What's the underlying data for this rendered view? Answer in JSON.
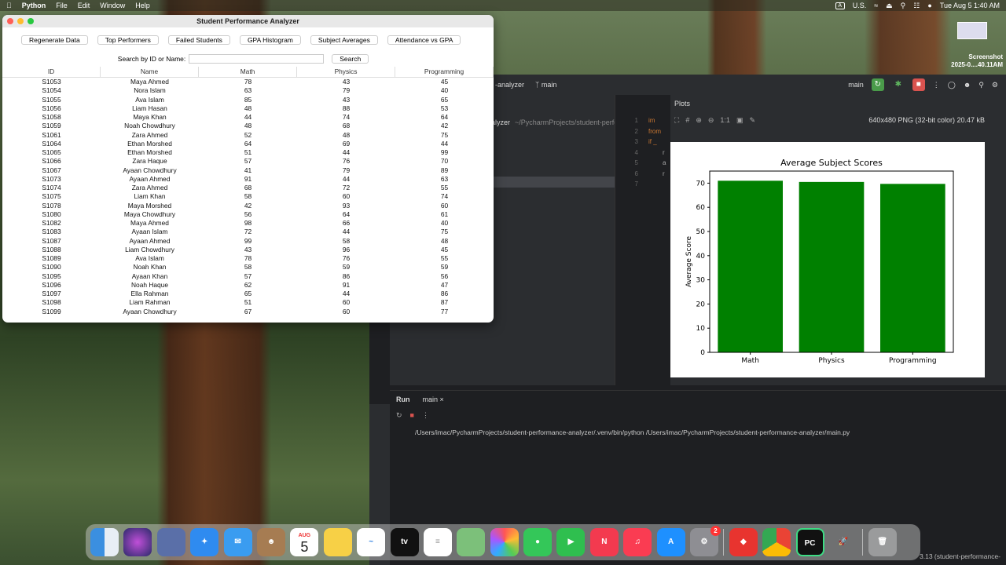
{
  "menubar": {
    "app": "Python",
    "items": [
      "File",
      "Edit",
      "Window",
      "Help"
    ],
    "input_lang": "U.S.",
    "datetime": "Tue Aug 5  1:40 AM"
  },
  "screenshot_thumb": {
    "title": "Screenshot",
    "subtitle": "2025-0....40.11AM"
  },
  "window": {
    "title": "Student Performance Analyzer",
    "buttons": [
      "Regenerate Data",
      "Top Performers",
      "Failed Students",
      "GPA Histogram",
      "Subject Averages",
      "Attendance vs GPA"
    ],
    "search_label": "Search by ID or Name:",
    "search_value": "",
    "search_button": "Search",
    "columns": [
      "ID",
      "Name",
      "Math",
      "Physics",
      "Programming"
    ],
    "rows": [
      [
        "S1053",
        "Maya Ahmed",
        "78",
        "43",
        "45"
      ],
      [
        "S1054",
        "Nora Islam",
        "63",
        "79",
        "40"
      ],
      [
        "S1055",
        "Ava Islam",
        "85",
        "43",
        "65"
      ],
      [
        "S1056",
        "Liam Hasan",
        "48",
        "88",
        "53"
      ],
      [
        "S1058",
        "Maya Khan",
        "44",
        "74",
        "64"
      ],
      [
        "S1059",
        "Noah Chowdhury",
        "48",
        "68",
        "42"
      ],
      [
        "S1061",
        "Zara Ahmed",
        "52",
        "48",
        "75"
      ],
      [
        "S1064",
        "Ethan Morshed",
        "64",
        "69",
        "44"
      ],
      [
        "S1065",
        "Ethan Morshed",
        "51",
        "44",
        "99"
      ],
      [
        "S1066",
        "Zara Haque",
        "57",
        "76",
        "70"
      ],
      [
        "S1067",
        "Ayaan Chowdhury",
        "41",
        "79",
        "89"
      ],
      [
        "S1073",
        "Ayaan Ahmed",
        "91",
        "44",
        "63"
      ],
      [
        "S1074",
        "Zara Ahmed",
        "68",
        "72",
        "55"
      ],
      [
        "S1075",
        "Liam Khan",
        "58",
        "60",
        "74"
      ],
      [
        "S1078",
        "Maya Morshed",
        "42",
        "93",
        "60"
      ],
      [
        "S1080",
        "Maya Chowdhury",
        "56",
        "64",
        "61"
      ],
      [
        "S1082",
        "Maya Ahmed",
        "98",
        "66",
        "40"
      ],
      [
        "S1083",
        "Ayaan Islam",
        "72",
        "44",
        "75"
      ],
      [
        "S1087",
        "Ayaan Ahmed",
        "99",
        "58",
        "48"
      ],
      [
        "S1088",
        "Liam Chowdhury",
        "43",
        "96",
        "45"
      ],
      [
        "S1089",
        "Ava Islam",
        "78",
        "76",
        "55"
      ],
      [
        "S1090",
        "Noah Khan",
        "58",
        "59",
        "59"
      ],
      [
        "S1095",
        "Ayaan Khan",
        "57",
        "86",
        "56"
      ],
      [
        "S1096",
        "Noah Haque",
        "62",
        "91",
        "47"
      ],
      [
        "S1097",
        "Ella Rahman",
        "65",
        "44",
        "86"
      ],
      [
        "S1098",
        "Liam Rahman",
        "51",
        "60",
        "87"
      ],
      [
        "S1099",
        "Ayaan Chowdhury",
        "67",
        "60",
        "77"
      ]
    ]
  },
  "ide": {
    "project_fragment": "-analyzer",
    "branch": "main",
    "run_config": "main",
    "project_label": "alyzer",
    "project_path": "~/PycharmProjects/student-perfo",
    "gutter": [
      "1",
      "2",
      "3",
      "4",
      "5",
      "6",
      "7"
    ],
    "code": [
      "im",
      "from",
      "",
      "if _",
      "r",
      "a",
      "r"
    ],
    "plots_title": "Plots",
    "zoom_label": "1:1",
    "image_info": "640x480 PNG (32-bit color) 20.47 kB",
    "run_tab": "Run",
    "run_config_tab": "main",
    "run_command": "/Users/imac/PycharmProjects/student-performance-analyzer/.venv/bin/python /Users/imac/PycharmProjects/student-performance-analyzer/main.py",
    "status_text": "3.13 (student-performance-"
  },
  "dock": {
    "calendar_month": "AUG",
    "calendar_day": "5",
    "settings_badge": "2"
  },
  "chart_data": {
    "type": "bar",
    "title": "Average Subject Scores",
    "xlabel": "",
    "ylabel": "Average Score",
    "categories": [
      "Math",
      "Physics",
      "Programming"
    ],
    "values": [
      71,
      70.5,
      69.7
    ],
    "ylim": [
      0,
      75
    ],
    "yticks": [
      0,
      10,
      20,
      30,
      40,
      50,
      60,
      70
    ],
    "bar_color": "#008000",
    "grid": false
  }
}
